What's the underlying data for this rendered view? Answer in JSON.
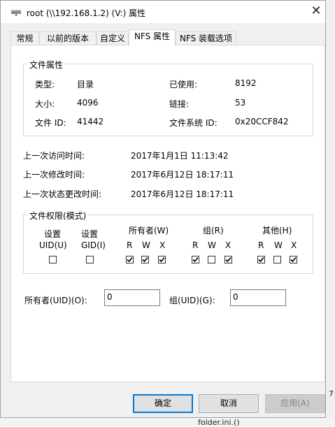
{
  "window": {
    "title": "root (\\\\192.168.1.2) (V:) 属性",
    "close_glyph": "✕"
  },
  "tabs": [
    {
      "label": "常规",
      "active": false
    },
    {
      "label": "以前的版本",
      "active": false
    },
    {
      "label": "自定义",
      "active": false
    },
    {
      "label": "NFS 属性",
      "active": true
    },
    {
      "label": "NFS 装载选项",
      "active": false
    }
  ],
  "file_attributes": {
    "legend": "文件属性",
    "type_label": "类型:",
    "type_value": "目录",
    "size_label": "大小:",
    "size_value": "4096",
    "fileid_label": "文件 ID:",
    "fileid_value": "41442",
    "used_label": "已使用:",
    "used_value": "8192",
    "links_label": "链接:",
    "links_value": "53",
    "fsid_label": "文件系统 ID:",
    "fsid_value": "0x20CCF842"
  },
  "times": {
    "access_label": "上一次访问时间:",
    "access_value": "2017年1月1日 11:13:42",
    "modify_label": "上一次修改时间:",
    "modify_value": "2017年6月12日 18:17:11",
    "change_label": "上一次状态更改时间:",
    "change_value": "2017年6月12日 18:17:11"
  },
  "permissions": {
    "legend": "文件权限(模式)",
    "setuid_label_1": "设置",
    "setuid_label_2": "UID(U)",
    "setuid_checked": false,
    "setgid_label_1": "设置",
    "setgid_label_2": "GID(I)",
    "setgid_checked": false,
    "owner_label": "所有者(W)",
    "group_label": "组(R)",
    "other_label": "其他(H)",
    "r": "R",
    "w": "W",
    "x": "X",
    "owner": {
      "r": true,
      "w": true,
      "x": true
    },
    "group": {
      "r": true,
      "w": false,
      "x": true
    },
    "other": {
      "r": true,
      "w": false,
      "x": true
    }
  },
  "ids": {
    "owner_uid_label": "所有者(UID)(O):",
    "owner_uid_value": "0",
    "group_gid_label": "组(UID)(G):",
    "group_gid_value": "0"
  },
  "buttons": {
    "ok": "确定",
    "cancel": "取消",
    "apply": "应用(A)"
  },
  "background": {
    "file_label": "folder.ini.()",
    "side_number": "7"
  }
}
